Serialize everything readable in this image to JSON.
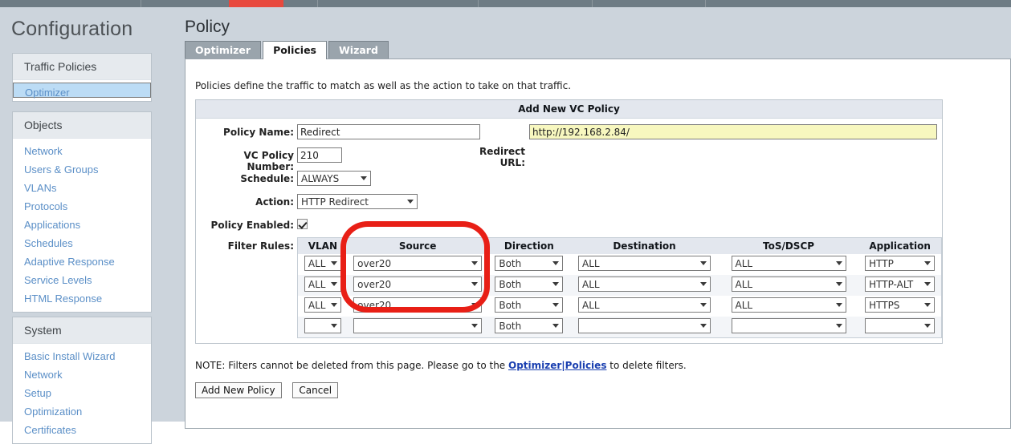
{
  "topnav": {
    "accent_color": "#e8493e",
    "bar_color": "#6e7c85"
  },
  "left": {
    "page_title": "Configuration",
    "cards": [
      {
        "header": "Traffic Policies",
        "items": [
          {
            "label": "Optimizer",
            "selected": true
          }
        ]
      },
      {
        "header": "Objects",
        "items": [
          {
            "label": "Network",
            "selected": false
          },
          {
            "label": "Users & Groups",
            "selected": false
          },
          {
            "label": "VLANs",
            "selected": false
          },
          {
            "label": "Protocols",
            "selected": false
          },
          {
            "label": "Applications",
            "selected": false
          },
          {
            "label": "Schedules",
            "selected": false
          },
          {
            "label": "Adaptive Response",
            "selected": false
          },
          {
            "label": "Service Levels",
            "selected": false
          },
          {
            "label": "HTML Response",
            "selected": false
          }
        ]
      },
      {
        "header": "System",
        "items": [
          {
            "label": "Basic Install Wizard",
            "selected": false
          },
          {
            "label": "Network",
            "selected": false
          },
          {
            "label": "Setup",
            "selected": false
          },
          {
            "label": "Optimization",
            "selected": false
          },
          {
            "label": "Certificates",
            "selected": false
          }
        ]
      }
    ]
  },
  "content": {
    "title": "Policy",
    "tabs": [
      {
        "label": "Optimizer",
        "active": false
      },
      {
        "label": "Policies",
        "active": true
      },
      {
        "label": "Wizard",
        "active": false
      }
    ],
    "intro": "Policies define the traffic to match as well as the action to take on that traffic."
  },
  "form": {
    "box_title": "Add New VC Policy",
    "policy_name_label": "Policy Name:",
    "policy_name_value": "Redirect",
    "redirect_url_label_line1": "Redirect",
    "redirect_url_label_line2": "URL:",
    "redirect_url_value": "http://192.168.2.84/",
    "vc_policy_number_label": "VC Policy Number:",
    "vc_policy_number_value": "210",
    "schedule_label": "Schedule:",
    "schedule_value": "ALWAYS",
    "action_label": "Action:",
    "action_value": "HTTP Redirect",
    "policy_enabled_label": "Policy Enabled:",
    "policy_enabled_checked": true,
    "filter_rules_label": "Filter Rules:"
  },
  "filter_table": {
    "columns": [
      "VLAN",
      "Source",
      "Direction",
      "Destination",
      "ToS/DSCP",
      "Application"
    ],
    "rows": [
      {
        "vlan": "ALL",
        "source": "over20",
        "direction": "Both",
        "destination": "ALL",
        "tos": "ALL",
        "application": "HTTP"
      },
      {
        "vlan": "ALL",
        "source": "over20",
        "direction": "Both",
        "destination": "ALL",
        "tos": "ALL",
        "application": "HTTP-ALT"
      },
      {
        "vlan": "ALL",
        "source": "over20",
        "direction": "Both",
        "destination": "ALL",
        "tos": "ALL",
        "application": "HTTPS"
      },
      {
        "vlan": "",
        "source": "",
        "direction": "Both",
        "destination": "",
        "tos": "",
        "application": ""
      }
    ]
  },
  "footer": {
    "note_prefix": "NOTE: Filters cannot be deleted from this page. Please go to the ",
    "note_link": "Optimizer|Policies",
    "note_suffix": " to delete filters.",
    "add_button": "Add New Policy",
    "cancel_button": "Cancel"
  },
  "annotation": {
    "color": "#e81f16",
    "target": "Source column"
  }
}
